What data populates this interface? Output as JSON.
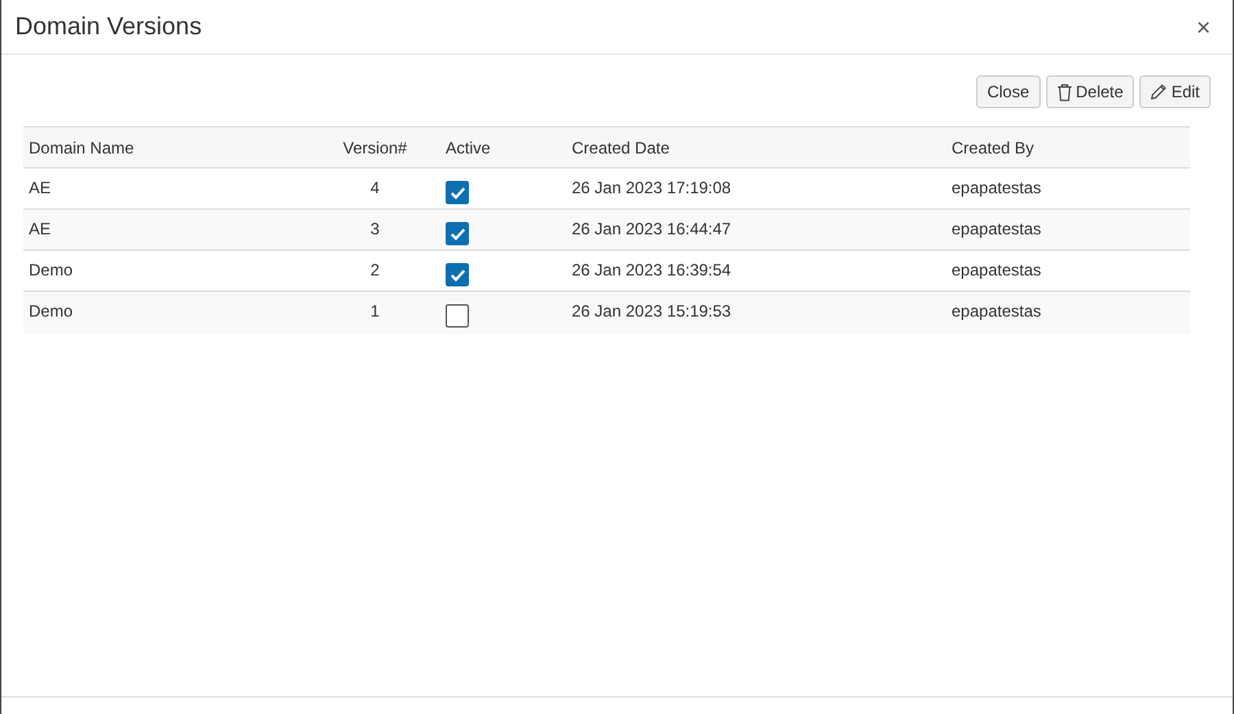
{
  "dialog": {
    "title": "Domain Versions",
    "close_glyph": "×"
  },
  "buttons": [
    {
      "kind": "plain",
      "label": "Close"
    },
    {
      "kind": "delete",
      "label": "Delete"
    },
    {
      "kind": "edit",
      "label": "Edit"
    }
  ],
  "table": {
    "columns": [
      "Domain Name",
      "Version#",
      "Active",
      "Created Date",
      "Created By"
    ],
    "rows": [
      {
        "domain_name": "AE",
        "version": "4",
        "active": true,
        "created_date": "26 Jan 2023 17:19:08",
        "created_by": "epapatestas"
      },
      {
        "domain_name": "AE",
        "version": "3",
        "active": true,
        "created_date": "26 Jan 2023 16:44:47",
        "created_by": "epapatestas"
      },
      {
        "domain_name": "Demo",
        "version": "2",
        "active": true,
        "created_date": "26 Jan 2023 16:39:54",
        "created_by": "epapatestas"
      },
      {
        "domain_name": "Demo",
        "version": "1",
        "active": false,
        "created_date": "26 Jan 2023 15:19:53",
        "created_by": "epapatestas"
      }
    ]
  }
}
